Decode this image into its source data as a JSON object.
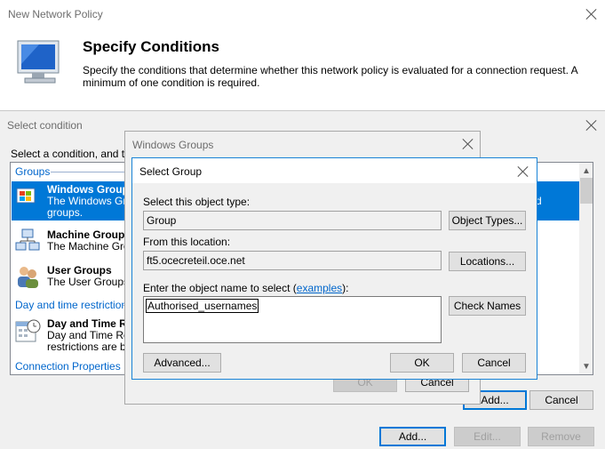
{
  "main_window": {
    "title": "New Network Policy",
    "heading": "Specify Conditions",
    "description": "Specify the conditions that determine whether this network policy is evaluated for a connection request. A minimum of one condition is required.",
    "buttons": {
      "add": "Add...",
      "edit": "Edit...",
      "remove": "Remove"
    }
  },
  "select_condition": {
    "title": "Select condition",
    "instruction": "Select a condition, and then",
    "groups_header": "Groups",
    "items": [
      {
        "title": "Windows Groups",
        "desc_line1": "The Windows Gro",
        "desc_line2": "groups."
      },
      {
        "title": "Machine Groups",
        "desc_line1": "The Machine Grou"
      },
      {
        "title": "User Groups",
        "desc_line1": "The User Groups"
      }
    ],
    "day_header": "Day and time restrictions",
    "day_item": {
      "title": "Day and Time Re",
      "desc_line1": "Day and Time Re",
      "desc_line2": "restrictions are ba"
    },
    "conn_header": "Connection Properties",
    "selected_suffix": "d",
    "buttons": {
      "add": "Add...",
      "cancel": "Cancel"
    }
  },
  "windows_groups": {
    "title": "Windows Groups",
    "buttons": {
      "ok": "OK",
      "cancel": "Cancel"
    }
  },
  "select_group": {
    "title": "Select Group",
    "object_type_label": "Select this object type:",
    "object_type_value": "Group",
    "object_types_button": "Object Types...",
    "location_label": "From this location:",
    "location_value": "ft5.ocecreteil.oce.net",
    "locations_button": "Locations...",
    "enter_label_prefix": "Enter the object name to select (",
    "examples_link": "examples",
    "enter_label_suffix": "):",
    "object_name_value": "Authorised_usernames",
    "check_names_button": "Check Names",
    "advanced_button": "Advanced...",
    "ok_button": "OK",
    "cancel_button": "Cancel"
  },
  "colors": {
    "accent": "#0078d7",
    "link": "#0066cc",
    "selection": "#0078d7"
  },
  "icons": [
    "network-monitor-icon",
    "windows-group-icon",
    "machine-group-icon",
    "user-group-icon",
    "calendar-clock-icon",
    "close-icon",
    "scroll-up-icon",
    "scroll-down-icon"
  ]
}
